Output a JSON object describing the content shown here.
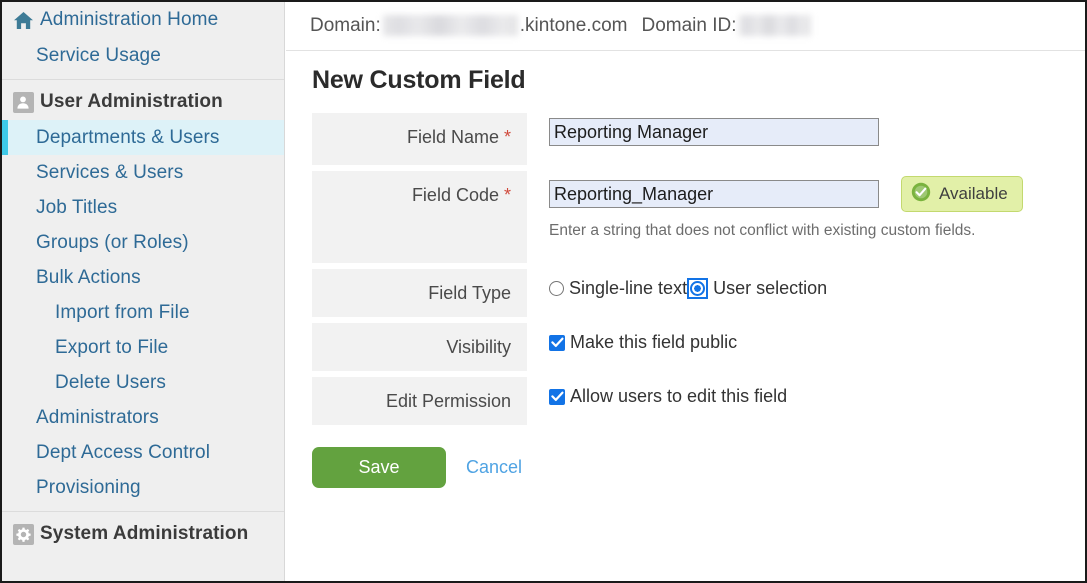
{
  "domain_bar": {
    "domain_label": "Domain:",
    "domain_value_redacted": true,
    "domain_suffix": ".kintone.com",
    "domain_id_label": "Domain ID:",
    "domain_id_redacted": true
  },
  "sidebar": {
    "groups": [
      {
        "items": [
          {
            "label": "Administration Home",
            "icon": "home-icon",
            "level": 0,
            "bold": false,
            "active": false
          },
          {
            "label": "Service Usage",
            "icon": null,
            "level": 1,
            "bold": false,
            "active": false
          }
        ]
      },
      {
        "items": [
          {
            "label": "User Administration",
            "icon": "user-icon",
            "level": 0,
            "bold": true,
            "active": false
          },
          {
            "label": "Departments & Users",
            "icon": null,
            "level": 1,
            "bold": false,
            "active": true
          },
          {
            "label": "Services & Users",
            "icon": null,
            "level": 1,
            "bold": false,
            "active": false
          },
          {
            "label": "Job Titles",
            "icon": null,
            "level": 1,
            "bold": false,
            "active": false
          },
          {
            "label": "Groups (or Roles)",
            "icon": null,
            "level": 1,
            "bold": false,
            "active": false
          },
          {
            "label": "Bulk Actions",
            "icon": null,
            "level": 1,
            "bold": false,
            "active": false
          },
          {
            "label": "Import from File",
            "icon": null,
            "level": 2,
            "bold": false,
            "active": false
          },
          {
            "label": "Export to File",
            "icon": null,
            "level": 2,
            "bold": false,
            "active": false
          },
          {
            "label": "Delete Users",
            "icon": null,
            "level": 2,
            "bold": false,
            "active": false
          },
          {
            "label": "Administrators",
            "icon": null,
            "level": 1,
            "bold": false,
            "active": false
          },
          {
            "label": "Dept Access Control",
            "icon": null,
            "level": 1,
            "bold": false,
            "active": false
          },
          {
            "label": "Provisioning",
            "icon": null,
            "level": 1,
            "bold": false,
            "active": false
          }
        ]
      },
      {
        "items": [
          {
            "label": "System Administration",
            "icon": "gear-icon",
            "level": 0,
            "bold": true,
            "active": false
          }
        ]
      }
    ]
  },
  "main": {
    "title": "New Custom Field",
    "fields": {
      "field_name": {
        "label": "Field Name",
        "required_marker": "*",
        "value": "Reporting Manager"
      },
      "field_code": {
        "label": "Field Code",
        "required_marker": "*",
        "value": "Reporting_Manager",
        "availability_badge": "Available",
        "help_text": "Enter a string that does not conflict with existing custom fields."
      },
      "field_type": {
        "label": "Field Type",
        "options": [
          {
            "label": "Single-line text",
            "selected": false,
            "focused": false
          },
          {
            "label": "User selection",
            "selected": true,
            "focused": true
          }
        ]
      },
      "visibility": {
        "label": "Visibility",
        "checkbox_label": "Make this field public",
        "checked": true
      },
      "edit_permission": {
        "label": "Edit Permission",
        "checkbox_label": "Allow users to edit this field",
        "checked": true
      }
    },
    "actions": {
      "save_label": "Save",
      "cancel_label": "Cancel"
    }
  },
  "colors": {
    "accent_active": "#3fc9e8",
    "link": "#2e6a96",
    "save_green": "#63a23f",
    "badge_green_bg": "#e2f0a8",
    "check_blue": "#1273e6",
    "required_red": "#d04a3c"
  }
}
